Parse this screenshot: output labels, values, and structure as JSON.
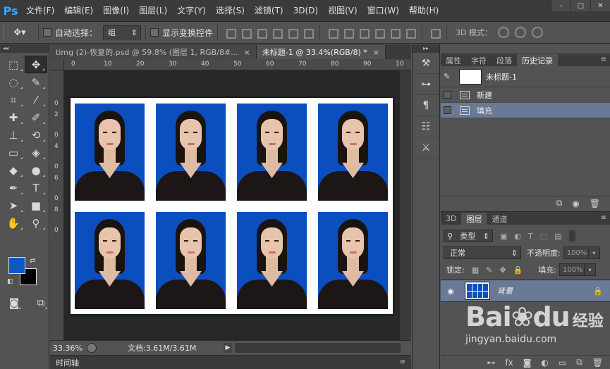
{
  "app": {
    "logo": "Ps"
  },
  "menu": [
    "文件(F)",
    "编辑(E)",
    "图像(I)",
    "图层(L)",
    "文字(Y)",
    "选择(S)",
    "滤镜(T)",
    "3D(D)",
    "视图(V)",
    "窗口(W)",
    "帮助(H)"
  ],
  "window_controls": {
    "minimize": "–",
    "maximize": "□",
    "close": "✕"
  },
  "options": {
    "tool_icon": "move-tool",
    "auto_select_label": "自动选择：",
    "auto_select_value": "组",
    "show_transform_label": "显示变换控件",
    "mode_3d_label": "3D 模式："
  },
  "toolbar": {
    "collapse": "◂◂"
  },
  "documents": {
    "tabs": [
      {
        "label": "timg (2)-恢复的.psd @ 59.8% (图层 1, RGB/8#...",
        "close": "×"
      },
      {
        "label": "未标题-1 @ 33.4%(RGB/8) *",
        "close": "×"
      }
    ]
  },
  "rulers": {
    "h_ticks": [
      "0",
      "10",
      "20",
      "30",
      "40",
      "50",
      "60",
      "70",
      "80",
      "90",
      "10"
    ],
    "v_ticks": [
      "0",
      "2",
      "0",
      "4",
      "0",
      "6",
      "0",
      "8",
      "0"
    ]
  },
  "canvas": {
    "background": "#ffffff",
    "photo_bg": "#0b4fbf"
  },
  "status": {
    "zoom": "33.36%",
    "doc_info": "文档:3.61M/3.61M",
    "arrow": "▶"
  },
  "timeline": {
    "label": "时间轴",
    "menu": "≡"
  },
  "colors": {
    "foreground": "#0f56c6",
    "background": "#000000"
  },
  "history_panel": {
    "tabs": [
      "属性",
      "字符",
      "段落",
      "历史记录"
    ],
    "active_tab": "历史记录",
    "menu": "≡",
    "snapshot_name": "未标题-1",
    "states": [
      {
        "label": "新建",
        "selected": false
      },
      {
        "label": "填充",
        "selected": true
      }
    ]
  },
  "layers_panel": {
    "tabs": [
      "3D",
      "图层",
      "通道"
    ],
    "active_tab": "图层",
    "menu": "≡",
    "filter_label": "类型",
    "blend_mode": "正常",
    "opacity_label": "不透明度:",
    "opacity_value": "100%",
    "lock_label": "锁定:",
    "fill_label": "填充:",
    "fill_value": "100%",
    "layer_name": "背景",
    "thumb_cells": [
      1,
      2,
      3,
      4,
      5,
      6,
      7,
      8
    ]
  },
  "watermark": {
    "logo": "Bai",
    "logo2": "du",
    "cn": "经验",
    "url": "jingyan.baidu.com"
  }
}
